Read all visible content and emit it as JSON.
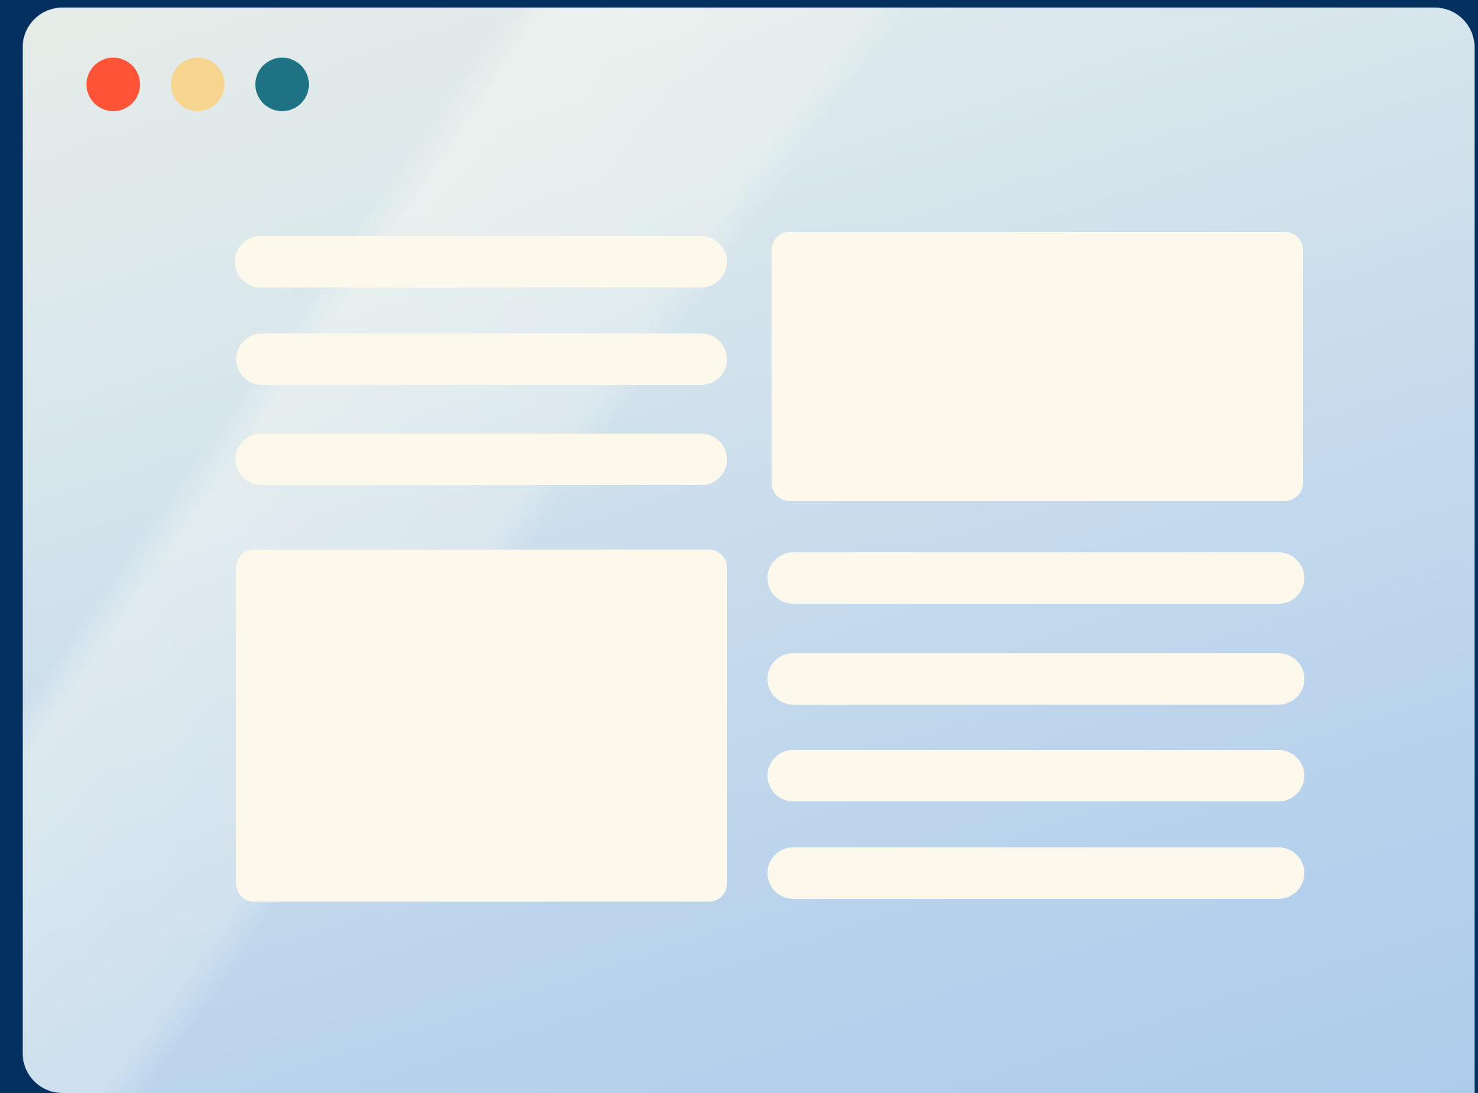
{
  "window_controls": [
    {
      "name": "close",
      "color": "#fd5438"
    },
    {
      "name": "minimize",
      "color": "#f6d58f"
    },
    {
      "name": "maximize",
      "color": "#1e7284"
    }
  ],
  "colors": {
    "backdrop": "#04305f",
    "placeholder": "#fcf8eb"
  },
  "content": {
    "left_column": {
      "text_lines": 3,
      "has_image_block": true
    },
    "right_column": {
      "has_image_block": true,
      "text_lines": 4
    }
  }
}
